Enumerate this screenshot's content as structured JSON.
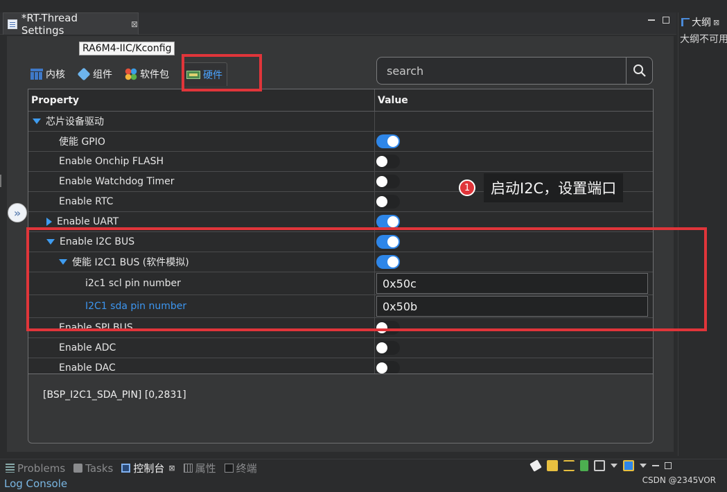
{
  "editor": {
    "tab_title": "*RT-Thread Settings",
    "tab_close": "⊠"
  },
  "outline": {
    "tab_label": "大纲",
    "tab_close": "⊠",
    "message": "大纲不可用"
  },
  "tooltip": "RA6M4-IIC/Kconfig",
  "category_tabs": [
    {
      "label": "内核",
      "icon": "kernel-grid-icon"
    },
    {
      "label": "组件",
      "icon": "component-cube-icon"
    },
    {
      "label": "软件包",
      "icon": "package-dots-icon"
    },
    {
      "label": "硬件",
      "icon": "hardware-board-icon",
      "active": true
    }
  ],
  "search": {
    "placeholder": "search",
    "value": ""
  },
  "table": {
    "headers": {
      "property": "Property",
      "value": "Value"
    },
    "rows": [
      {
        "label": "芯片设备驱动",
        "indent": 0,
        "expander": "expanded",
        "value_type": "none"
      },
      {
        "label": "使能 GPIO",
        "indent": 1,
        "expander": "none",
        "value_type": "toggle",
        "on": true
      },
      {
        "label": "Enable Onchip FLASH",
        "indent": 1,
        "expander": "none",
        "value_type": "toggle",
        "on": false
      },
      {
        "label": "Enable Watchdog Timer",
        "indent": 1,
        "expander": "none",
        "value_type": "toggle",
        "on": false
      },
      {
        "label": "Enable RTC",
        "indent": 1,
        "expander": "none",
        "value_type": "toggle",
        "on": false
      },
      {
        "label": "Enable UART",
        "indent": 1,
        "expander": "collapsed",
        "value_type": "toggle",
        "on": true
      },
      {
        "label": "Enable I2C BUS",
        "indent": 1,
        "expander": "expanded",
        "value_type": "toggle",
        "on": true
      },
      {
        "label": "使能 I2C1 BUS (软件模拟)",
        "indent": 2,
        "expander": "expanded",
        "value_type": "toggle",
        "on": true
      },
      {
        "label": "i2c1 scl pin number",
        "indent": 3,
        "expander": "none",
        "value_type": "text",
        "value": "0x50c"
      },
      {
        "label": "I2C1 sda pin number",
        "indent": 3,
        "expander": "none",
        "value_type": "text",
        "value": "0x50b",
        "selected": true
      },
      {
        "label": "Enable SPI BUS",
        "indent": 1,
        "expander": "none",
        "value_type": "toggle",
        "on": false
      },
      {
        "label": "Enable ADC",
        "indent": 1,
        "expander": "none",
        "value_type": "toggle",
        "on": false
      },
      {
        "label": "Enable DAC",
        "indent": 1,
        "expander": "none",
        "value_type": "toggle",
        "on": false
      }
    ]
  },
  "info_text": "[BSP_I2C1_SDA_PIN] [0,2831]",
  "annotation": {
    "number": "1",
    "text": "启动I2C，设置端口"
  },
  "expand_button": "»",
  "bottom_tabs": [
    {
      "label": "Problems",
      "icon": "problems-icon",
      "active": false
    },
    {
      "label": "Tasks",
      "icon": "tasks-icon",
      "active": false
    },
    {
      "label": "控制台",
      "icon": "console-icon",
      "active": true
    },
    {
      "label": "属性",
      "icon": "properties-icon",
      "active": false
    },
    {
      "label": "终端",
      "icon": "terminal-icon",
      "active": false
    }
  ],
  "console_title": "Log Console",
  "watermark": "CSDN @2345VOR",
  "colors": {
    "accent": "#3f9cf0",
    "highlight": "#e0353a",
    "toggle_on": "#2e86e8"
  }
}
